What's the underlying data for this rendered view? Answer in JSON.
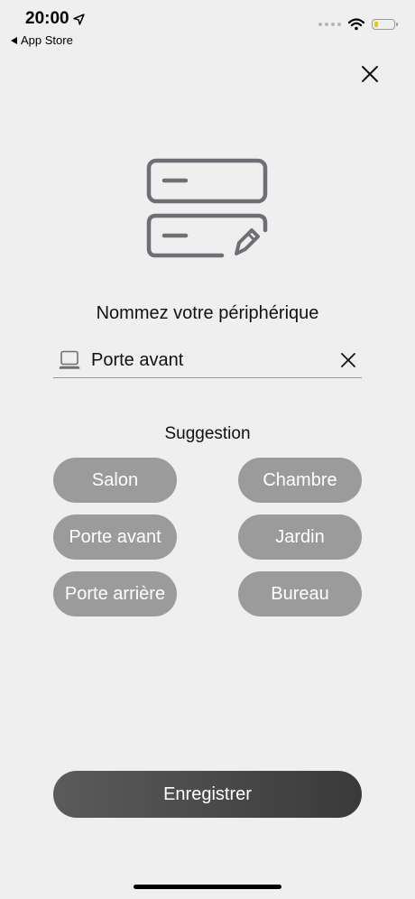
{
  "status_bar": {
    "time": "20:00",
    "back_app": "App Store",
    "battery_level": 0.2
  },
  "icons": {
    "close": "close-icon",
    "device_name": "device-rename-icon",
    "field_device": "device-icon",
    "field_clear": "clear-icon"
  },
  "page": {
    "title": "Nommez votre périphérique"
  },
  "name_field": {
    "value": "Porte avant"
  },
  "suggestions": {
    "title": "Suggestion",
    "items": [
      "Salon",
      "Chambre",
      "Porte avant",
      "Jardin",
      "Porte arrière",
      "Bureau"
    ]
  },
  "actions": {
    "save_label": "Enregistrer"
  },
  "colors": {
    "background": "#efefef",
    "chip": "#9b9b9b",
    "icon_stroke": "#6e6e75",
    "save_button_start": "#5b5b5b",
    "save_button_end": "#3a3a3a"
  }
}
